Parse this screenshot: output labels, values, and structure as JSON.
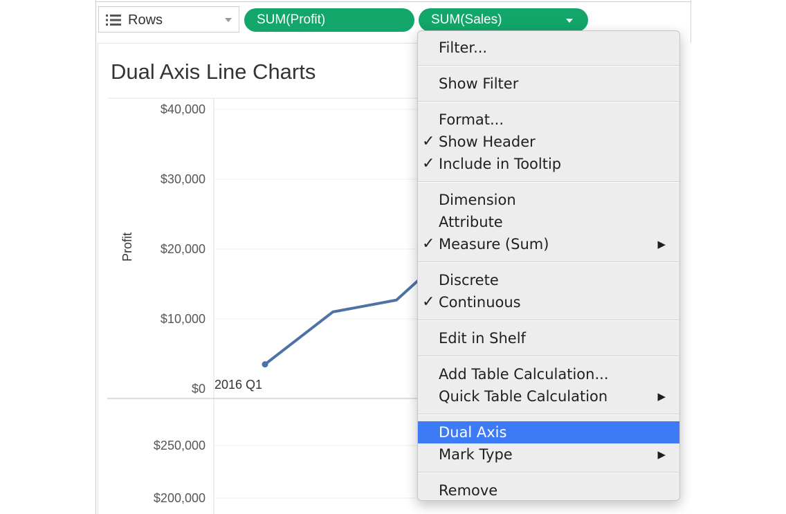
{
  "shelf": {
    "rows_label": "Rows",
    "pills": [
      "SUM(Profit)",
      "SUM(Sales)"
    ]
  },
  "sheet": {
    "title": "Dual Axis Line Charts"
  },
  "chart_data": {
    "type": "line",
    "title": "Dual Axis Line Charts",
    "ylabel": "Profit",
    "y_ticks": [
      "$40,000",
      "$30,000",
      "$20,000",
      "$10,000",
      "$0"
    ],
    "ylim": [
      0,
      40000
    ],
    "first_point_label": "2016 Q1",
    "series": [
      {
        "name": "SUM(Profit)",
        "values": [
          3500,
          11000,
          12700,
          16000
        ]
      }
    ],
    "lower_axis_ticks": [
      "$250,000",
      "$200,000"
    ],
    "line_color": "#4e72a6"
  },
  "menu": {
    "items": [
      {
        "label": "Filter...",
        "checked": false,
        "submenu": false
      },
      {
        "label": "Show Filter",
        "checked": false,
        "submenu": false
      },
      {
        "label": "Format...",
        "checked": false,
        "submenu": false
      },
      {
        "label": "Show Header",
        "checked": true,
        "submenu": false
      },
      {
        "label": "Include in Tooltip",
        "checked": true,
        "submenu": false
      },
      {
        "label": "Dimension",
        "checked": false,
        "submenu": false
      },
      {
        "label": "Attribute",
        "checked": false,
        "submenu": false
      },
      {
        "label": "Measure (Sum)",
        "checked": true,
        "submenu": true
      },
      {
        "label": "Discrete",
        "checked": false,
        "submenu": false
      },
      {
        "label": "Continuous",
        "checked": true,
        "submenu": false
      },
      {
        "label": "Edit in Shelf",
        "checked": false,
        "submenu": false
      },
      {
        "label": "Add Table Calculation...",
        "checked": false,
        "submenu": false
      },
      {
        "label": "Quick Table Calculation",
        "checked": false,
        "submenu": true
      },
      {
        "label": "Dual Axis",
        "checked": false,
        "submenu": false,
        "highlighted": true
      },
      {
        "label": "Mark Type",
        "checked": false,
        "submenu": true
      },
      {
        "label": "Remove",
        "checked": false,
        "submenu": false
      }
    ],
    "check_glyph": "✓",
    "submenu_glyph": "▶"
  },
  "colors": {
    "pill": "#12a66a",
    "highlight": "#3d7af5",
    "line": "#4e72a6"
  }
}
